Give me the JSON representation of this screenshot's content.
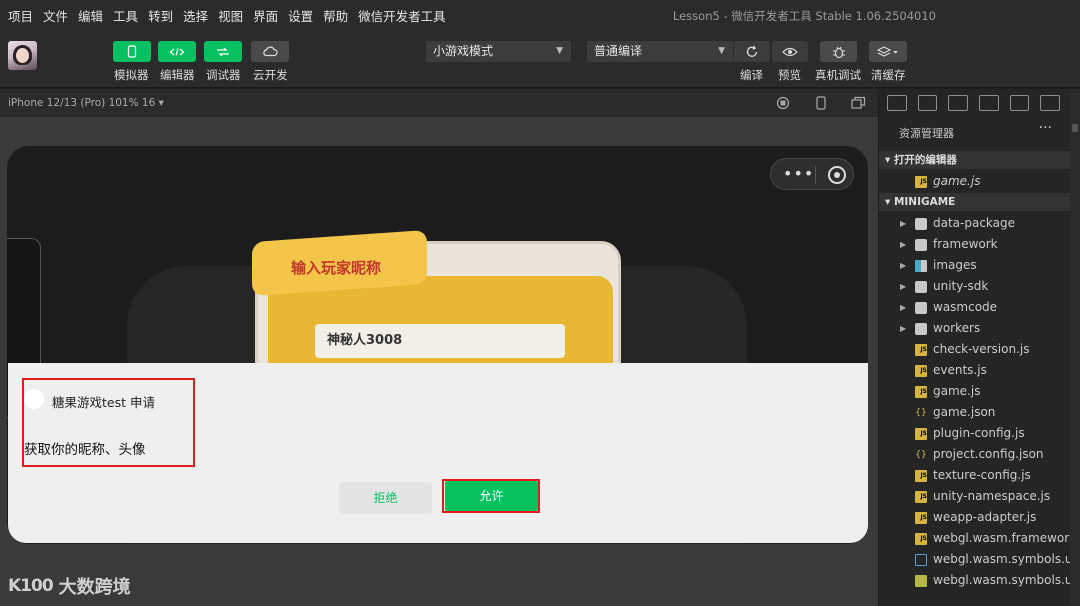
{
  "menu": [
    "项目",
    "文件",
    "编辑",
    "工具",
    "转到",
    "选择",
    "视图",
    "界面",
    "设置",
    "帮助",
    "微信开发者工具"
  ],
  "window_title": "Lesson5 - 微信开发者工具 Stable 1.06.2504010",
  "toolbar": {
    "simulator": "模拟器",
    "editor": "编辑器",
    "debugger": "调试器",
    "cloud": "云开发",
    "mode_select": "小游戏模式",
    "compile_select": "普通编译",
    "compile": "编译",
    "preview": "预览",
    "real_device_debug": "真机调试",
    "clear_cache": "清缓存"
  },
  "device_info": "iPhone 12/13 (Pro) 101% 16 ▾",
  "game": {
    "card_title": "输入玩家昵称",
    "nickname": "神秘人3008"
  },
  "auth_dialog": {
    "app_name": "糖果游戏test  申请",
    "permission": "获取你的昵称、头像",
    "reject": "拒绝",
    "allow": "允许"
  },
  "watermark": "大数跨境",
  "watermark_logo": "K100",
  "explorer": {
    "title": "资源管理器",
    "more": "···",
    "open_editors": "打开的编辑器",
    "open_file": "game.js",
    "project": "MINIGAME",
    "items": [
      {
        "name": "data-package",
        "type": "folder"
      },
      {
        "name": "framework",
        "type": "folder"
      },
      {
        "name": "images",
        "type": "folder-special"
      },
      {
        "name": "unity-sdk",
        "type": "folder"
      },
      {
        "name": "wasmcode",
        "type": "folder"
      },
      {
        "name": "workers",
        "type": "folder"
      },
      {
        "name": "check-version.js",
        "type": "js"
      },
      {
        "name": "events.js",
        "type": "js"
      },
      {
        "name": "game.js",
        "type": "js"
      },
      {
        "name": "game.json",
        "type": "json"
      },
      {
        "name": "plugin-config.js",
        "type": "js"
      },
      {
        "name": "project.config.json",
        "type": "json"
      },
      {
        "name": "texture-config.js",
        "type": "js"
      },
      {
        "name": "unity-namespace.js",
        "type": "js"
      },
      {
        "name": "weapp-adapter.js",
        "type": "js"
      },
      {
        "name": "webgl.wasm.framework...",
        "type": "js"
      },
      {
        "name": "webgl.wasm.symbols.u...",
        "type": "symbols"
      },
      {
        "name": "webgl.wasm.symbols.u...",
        "type": "symbols2"
      }
    ]
  },
  "colors": {
    "accent": "#07c160",
    "highlight": "#e01b1b",
    "card_yellow": "#e8b834",
    "title_red": "#c2382c"
  }
}
